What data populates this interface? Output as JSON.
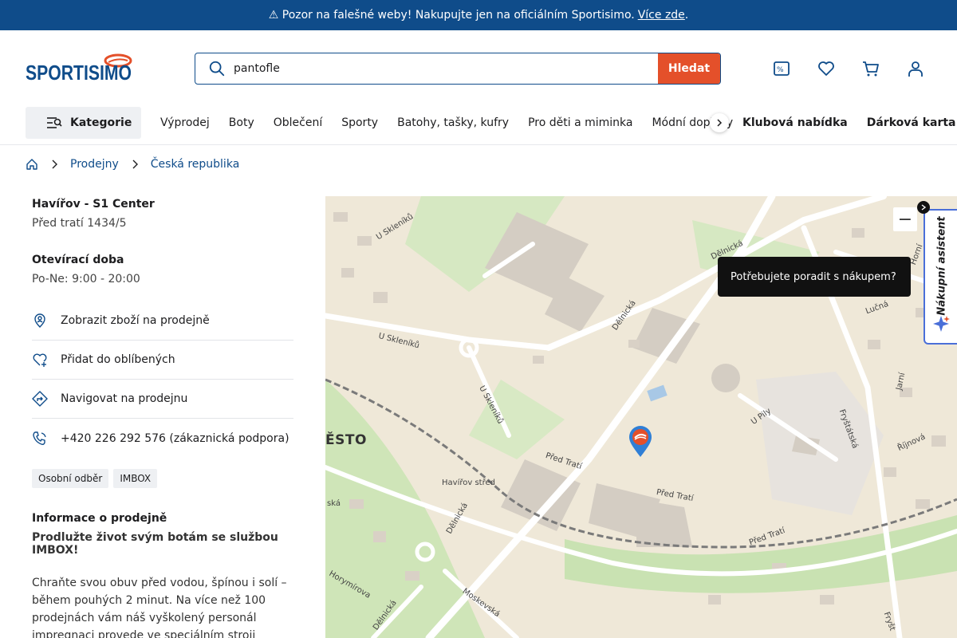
{
  "banner": {
    "text": "⚠ Pozor na falešné weby! Nakupujte jen na oficiálním Sportisimo.",
    "link": "Více zde",
    "end": "."
  },
  "header": {
    "logo_text": "SPORTISIMO",
    "search_value": "pantofle",
    "search_button": "Hledat",
    "icons": [
      "compare-icon",
      "heart-icon",
      "cart-icon",
      "user-icon"
    ]
  },
  "nav": {
    "kategorie": "Kategorie",
    "items": [
      "Výprodej",
      "Boty",
      "Oblečení",
      "Sporty",
      "Batohy, tašky, kufry",
      "Pro děti a miminka",
      "Módní doplňky"
    ],
    "right": [
      "Klubová nabídka",
      "Dárková karta"
    ]
  },
  "breadcrumb": [
    "Prodejny",
    "Česká republika"
  ],
  "store": {
    "name": "Havířov - S1 Center",
    "address": "Před tratí 1434/5",
    "hours_title": "Otevírací doba",
    "hours": "Po-Ne: 9:00 - 20:00",
    "actions": [
      {
        "label": "Zobrazit zboží na prodejně",
        "icon": "location-person-icon"
      },
      {
        "label": "Přidat do oblíbených",
        "icon": "heart-plus-icon"
      },
      {
        "label": "Navigovat na prodejnu",
        "icon": "directions-icon"
      },
      {
        "label": "+420 226 292 576 (zákaznická podpora)",
        "icon": "phone-icon"
      }
    ],
    "tags": [
      "Osobní odběr",
      "IMBOX"
    ],
    "info_title": "Informace o prodejně",
    "info_sub": "Prodlužte život svým botám se službou IMBOX!",
    "info_text": "Chraňte svou obuv před vodou, špínou i solí – během pouhých 2 minut. Na více než 100 prodejnách vám náš vyškolený personál impregnaci provede ve speciálním stroji IMBOX, a"
  },
  "map": {
    "tooltip": "Potřebujete poradit s nákupem?",
    "assistant": "Nákupní asistent",
    "city": "ĚSTO",
    "zoom_out": "−",
    "streets": [
      "U Skleníků",
      "Dělnická",
      "U Skleníků",
      "U Skleníků",
      "Dělnická",
      "Před Tratí",
      "Před Tratí",
      "Havířov střed",
      "Dělnická",
      "Před Tratí",
      "U Pily",
      "Fryštátská",
      "Jarní",
      "Říjnová",
      "Horymírova",
      "Dělnická",
      "Moskevská",
      "Fryšt",
      "Lučná",
      "Horní",
      "ská"
    ]
  },
  "colors": {
    "brand_blue": "#0f4c8a",
    "accent_orange": "#e4502a"
  }
}
